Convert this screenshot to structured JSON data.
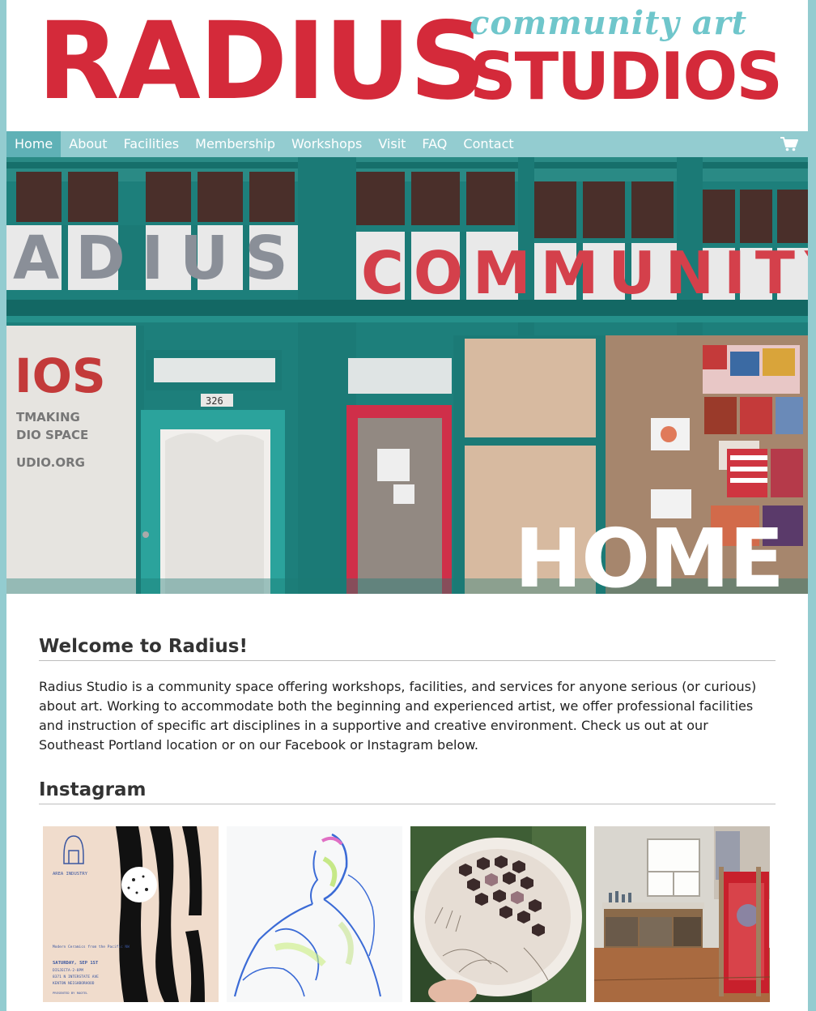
{
  "logo": {
    "word_main": "RADIUS",
    "word_small": "community art",
    "word_studios": "STUDIOS",
    "primary_color": "#d42a3a",
    "accent_color": "#6fc6cb"
  },
  "nav": {
    "items": [
      "Home",
      "About",
      "Facilities",
      "Membership",
      "Workshops",
      "Visit",
      "FAQ",
      "Contact"
    ],
    "active": "Home",
    "cart_icon": "shopping-cart-icon",
    "bar_color": "#93ccd0",
    "active_color": "#5fb1b6"
  },
  "hero": {
    "title": "HOME",
    "window_letters_left": "ADIUS",
    "window_letters_right": "COMMUNITY",
    "door_number": "326",
    "side_sign_big": "IOS",
    "side_sign_lines": [
      "TMAKING",
      "DIO SPACE",
      "UDIO.ORG"
    ]
  },
  "welcome": {
    "heading": "Welcome to Radius!",
    "body": "Radius Studio is a community space offering workshops, facilities, and services for anyone serious (or curious) about art. Working to accommodate both the beginning and experienced artist, we offer professional facilities and instruction of specific art disciplines in a supportive and creative environment. Check us out at our Southeast Portland location or on our Facebook or Instagram below."
  },
  "instagram": {
    "heading": "Instagram",
    "posts": [
      {
        "label": "AREA INDUSTRY",
        "sub": "Modern Ceramics from the Pacific NW",
        "date": "SATURDAY, SEP 1ST",
        "l1": "DISJECTA·2-8PM",
        "l2": "8371 N INTERSTATE AVE",
        "l3": "KENTON NEIGHBORHOOD",
        "l4": "PRESENTED BY ROOTEL"
      },
      {
        "label": "figure drawing"
      },
      {
        "label": "ceramic bowl"
      },
      {
        "label": "studio interior"
      }
    ]
  }
}
